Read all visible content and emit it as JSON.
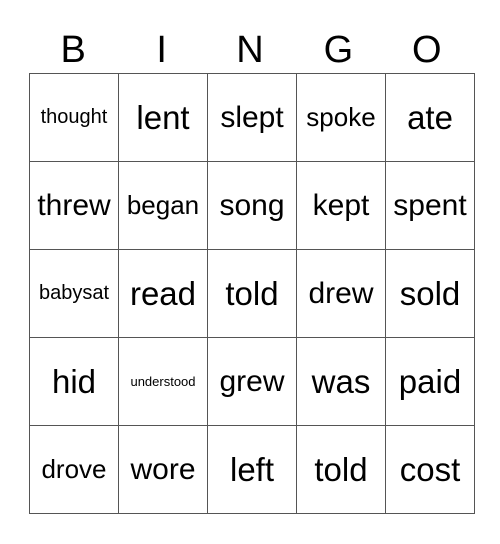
{
  "header": [
    "B",
    "I",
    "N",
    "G",
    "O"
  ],
  "rows": [
    [
      "thought",
      "lent",
      "slept",
      "spoke",
      "ate"
    ],
    [
      "threw",
      "began",
      "song",
      "kept",
      "spent"
    ],
    [
      "babysat",
      "read",
      "told",
      "drew",
      "sold"
    ],
    [
      "hid",
      "understood",
      "grew",
      "was",
      "paid"
    ],
    [
      "drove",
      "wore",
      "left",
      "told",
      "cost"
    ]
  ]
}
